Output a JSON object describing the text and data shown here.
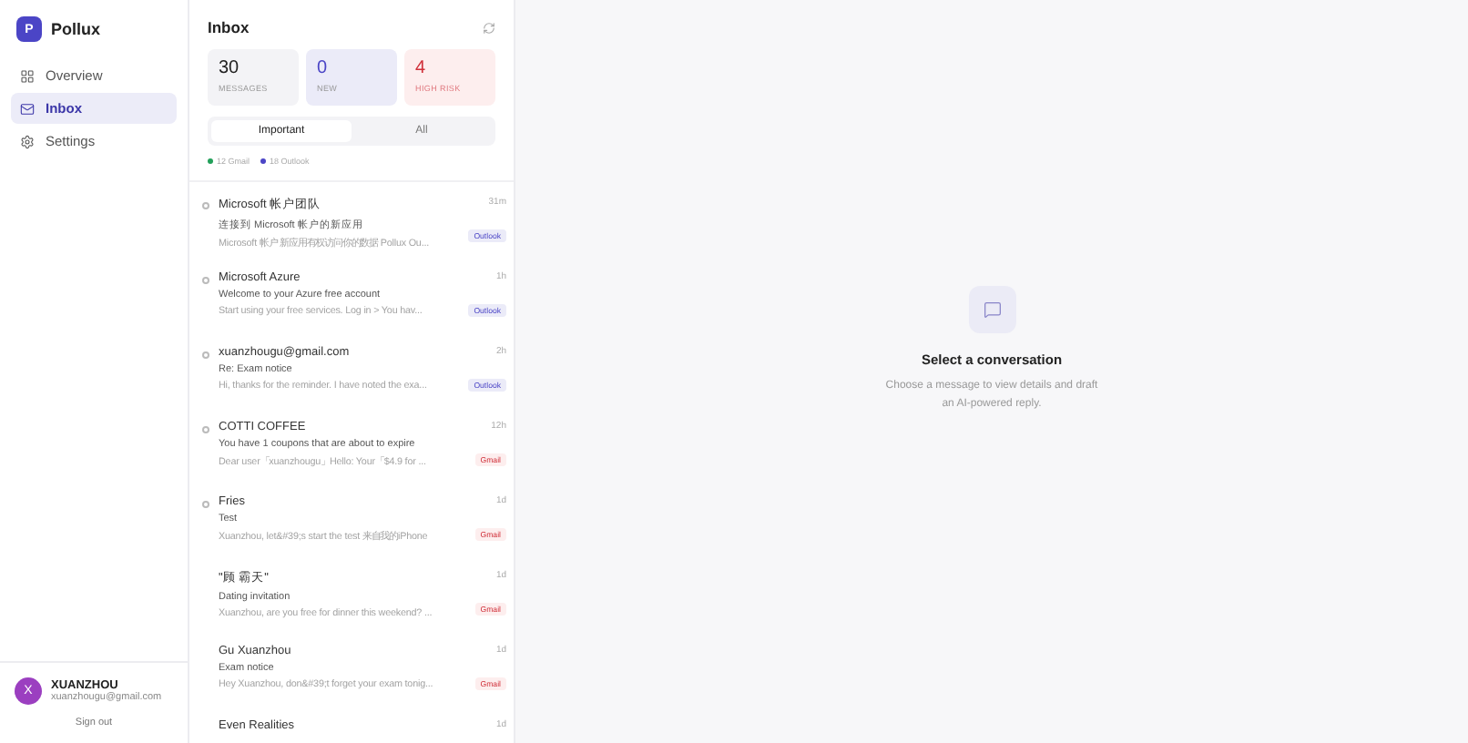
{
  "brand": {
    "logo": "P",
    "name": "Pollux"
  },
  "nav": [
    {
      "label": "Overview",
      "kind": "grid",
      "selected": false
    },
    {
      "label": "Inbox",
      "kind": "mail",
      "selected": true
    },
    {
      "label": "Settings",
      "kind": "gear",
      "selected": false
    }
  ],
  "user": {
    "initial": "X",
    "name": "XUANZHOU",
    "email": "xuanzhougu@gmail.com",
    "sign_out": "Sign out"
  },
  "inbox": {
    "title": "Inbox",
    "stats": [
      {
        "value": "30",
        "label": "MESSAGES",
        "kind": "neutral"
      },
      {
        "value": "0",
        "label": "NEW",
        "kind": "new"
      },
      {
        "value": "4",
        "label": "HIGH RISK",
        "kind": "risk"
      }
    ],
    "tabs": [
      {
        "label": "Important",
        "selected": true
      },
      {
        "label": "All",
        "selected": false
      }
    ],
    "sources": [
      {
        "label": "12 Gmail",
        "color": "#22a05a"
      },
      {
        "label": "18 Outlook",
        "color": "#4b45c6"
      }
    ],
    "messages": [
      {
        "sender": "Microsoft 帐户团队",
        "subject": "连接到 Microsoft 帐户的新应用",
        "preview": "Microsoft 帐户 新应用有权访问你的数据 Pollux Ou...",
        "time": "31m",
        "tag": "Outlook",
        "unread": true
      },
      {
        "sender": "Microsoft Azure",
        "subject": "Welcome to your Azure free account",
        "preview": "Start using your free services. Log in > You hav...",
        "time": "1h",
        "tag": "Outlook",
        "unread": true
      },
      {
        "sender": "xuanzhougu@gmail.com",
        "subject": "Re: Exam notice",
        "preview": "Hi, thanks for the reminder. I have noted the exa...",
        "time": "2h",
        "tag": "Outlook",
        "unread": true
      },
      {
        "sender": "COTTI COFFEE",
        "subject": "You have 1 coupons that are about to expire",
        "preview": "Dear user「xuanzhougu」Hello: Your「$4.9 for ...",
        "time": "12h",
        "tag": "Gmail",
        "unread": true
      },
      {
        "sender": "Fries",
        "subject": "Test",
        "preview": "Xuanzhou, let&#39;s start the test 来自我的iPhone",
        "time": "1d",
        "tag": "Gmail",
        "unread": true
      },
      {
        "sender": "\"顾 霸天\"",
        "subject": "Dating invitation",
        "preview": "Xuanzhou, are you free for dinner this weekend? ...",
        "time": "1d",
        "tag": "Gmail",
        "unread": false
      },
      {
        "sender": "Gu Xuanzhou",
        "subject": "Exam notice",
        "preview": "Hey Xuanzhou, don&#39;t forget your exam tonig...",
        "time": "1d",
        "tag": "Gmail",
        "unread": false
      },
      {
        "sender": "Even Realities",
        "time": "1d",
        "unread": false
      }
    ]
  },
  "empty": {
    "title": "Select a conversation",
    "text": "Choose a message to view details and draft an AI-powered reply."
  }
}
